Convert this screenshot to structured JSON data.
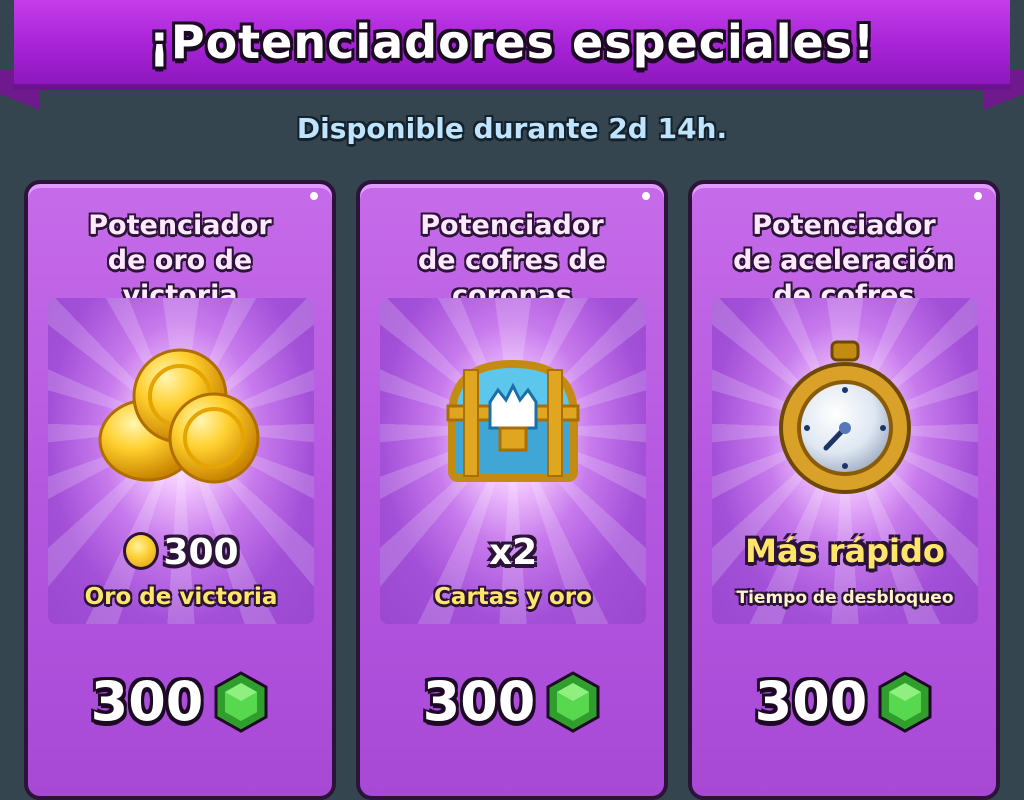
{
  "header": {
    "title": "¡Potenciadores especiales!",
    "subtitle": "Disponible durante 2d 14h."
  },
  "cards": [
    {
      "title_lines": [
        "Potenciador",
        "de oro de",
        "victoria"
      ],
      "icon": "gold-coins-icon",
      "value": "300",
      "value_icon": "gold-coin-icon",
      "description": "Oro de victoria",
      "price": "300",
      "price_icon": "green-gem-icon"
    },
    {
      "title_lines": [
        "Potenciador",
        "de cofres de",
        "coronas"
      ],
      "icon": "crown-chest-icon",
      "value": "x2",
      "description": "Cartas y oro",
      "price": "300",
      "price_icon": "green-gem-icon"
    },
    {
      "title_lines": [
        "Potenciador",
        "de aceleración",
        "de cofres"
      ],
      "icon": "stopwatch-icon",
      "value": "Más rápido",
      "description": "Tiempo de desbloqueo",
      "price": "300",
      "price_icon": "green-gem-icon"
    }
  ],
  "colors": {
    "background": "#35454f",
    "banner": "#a623d6",
    "card": "#b558e0",
    "gem": "#3fc83a",
    "gold": "#ffd23a"
  }
}
